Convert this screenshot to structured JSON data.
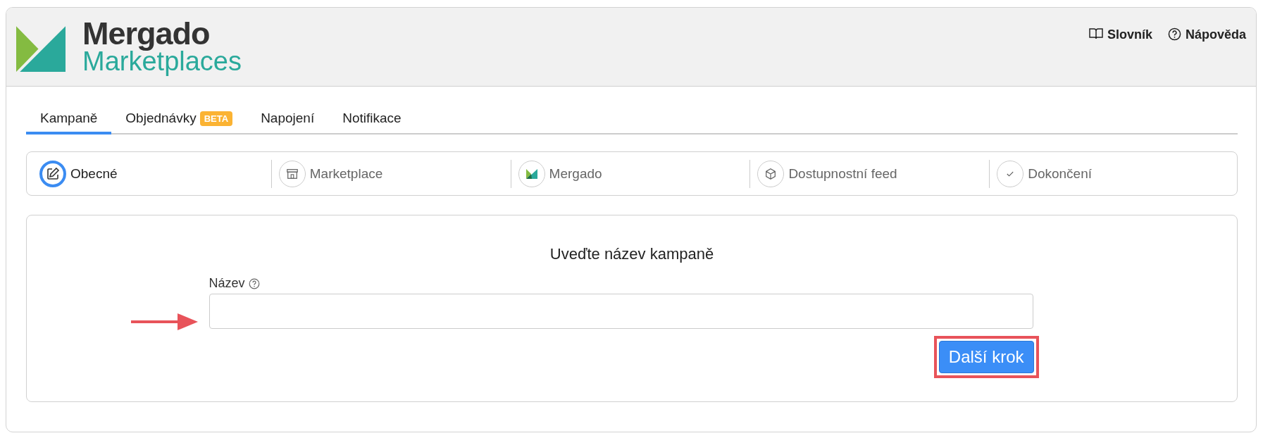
{
  "header": {
    "logo": {
      "title": "Mergado",
      "subtitle": "Marketplaces"
    },
    "links": [
      {
        "label": "Slovník"
      },
      {
        "label": "Nápověda"
      }
    ]
  },
  "tabs": [
    {
      "label": "Kampaně",
      "selected": true
    },
    {
      "label": "Objednávky",
      "selected": false,
      "badge": "BETA"
    },
    {
      "label": "Napojení",
      "selected": false
    },
    {
      "label": "Notifikace",
      "selected": false
    }
  ],
  "steps": [
    {
      "label": "Obecné",
      "selected": true
    },
    {
      "label": "Marketplace",
      "selected": false
    },
    {
      "label": "Mergado",
      "selected": false
    },
    {
      "label": "Dostupnostní feed",
      "selected": false
    },
    {
      "label": "Dokončení",
      "selected": false
    }
  ],
  "form": {
    "heading": "Uveďte název kampaně",
    "field_label": "Název",
    "button": "Další krok"
  }
}
